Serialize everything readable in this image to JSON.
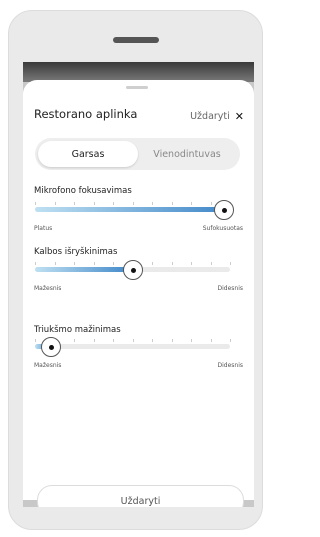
{
  "sheet": {
    "title": "Restorano aplinka",
    "close_label": "Uždaryti",
    "close_icon": "close-icon"
  },
  "tabs": [
    {
      "label": "Garsas",
      "active": true
    },
    {
      "label": "Vienodintuvas",
      "active": false
    }
  ],
  "sliders": [
    {
      "label": "Mikrofono fokusavimas",
      "min_label": "Platus",
      "max_label": "Sufokusuotas",
      "value_percent": 100
    },
    {
      "label": "Kalbos išryškinimas",
      "min_label": "Mažesnis",
      "max_label": "Didesnis",
      "value_percent": 50
    },
    {
      "label": "Triukšmo mažinimas",
      "min_label": "Mažesnis",
      "max_label": "Didesnis",
      "value_percent": 8
    }
  ],
  "footer": {
    "button_label": "Uždaryti"
  },
  "colors": {
    "accent": "#3e86c8",
    "accent_light": "#bfe0f2"
  }
}
